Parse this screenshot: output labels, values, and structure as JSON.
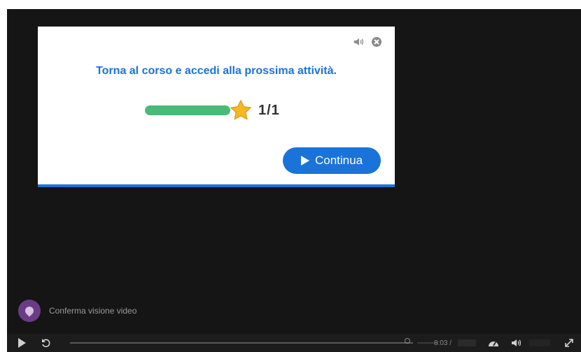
{
  "modal": {
    "message": "Torna al corso e accedi alla prossima attività.",
    "progress_fraction": 1.0,
    "progress_count": "1/1",
    "continue_label": "Continua",
    "icons": [
      "speaker-icon",
      "close-icon",
      "star-icon",
      "play-icon"
    ]
  },
  "overlay": {
    "confirm_label": "Conferma visione video"
  },
  "controls": {
    "time": "8:03 /",
    "icons": [
      "play-icon",
      "rewind-icon",
      "speed-icon",
      "volume-icon",
      "fullscreen-icon"
    ]
  },
  "colors": {
    "accent": "#1a73d8",
    "progress": "#47bb77",
    "star": "#f5b823",
    "player_bg": "#151515"
  }
}
